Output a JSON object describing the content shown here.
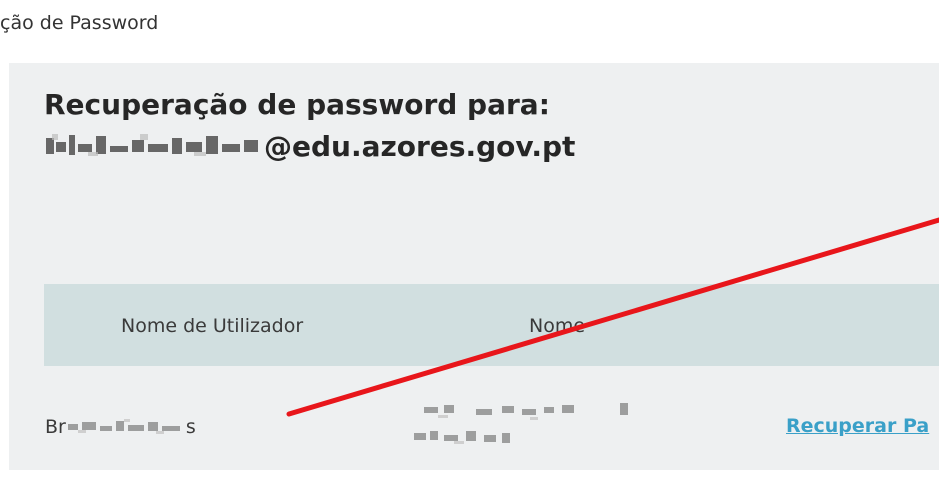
{
  "window": {
    "title": "ção de Password"
  },
  "heading": {
    "line1": "Recuperação de password para:",
    "email_domain": "@edu.azores.gov.pt"
  },
  "table": {
    "headers": [
      "Nome de Utilizador",
      "Nome"
    ],
    "rows": [
      {
        "username_prefix": "Br",
        "username_suffix": "s",
        "action": "Recuperar Pa"
      }
    ]
  },
  "colors": {
    "panel": "#eef0f1",
    "table_header": "#d1dfe0",
    "link": "#3aa0c8",
    "annotation_line": "#e8161b"
  }
}
